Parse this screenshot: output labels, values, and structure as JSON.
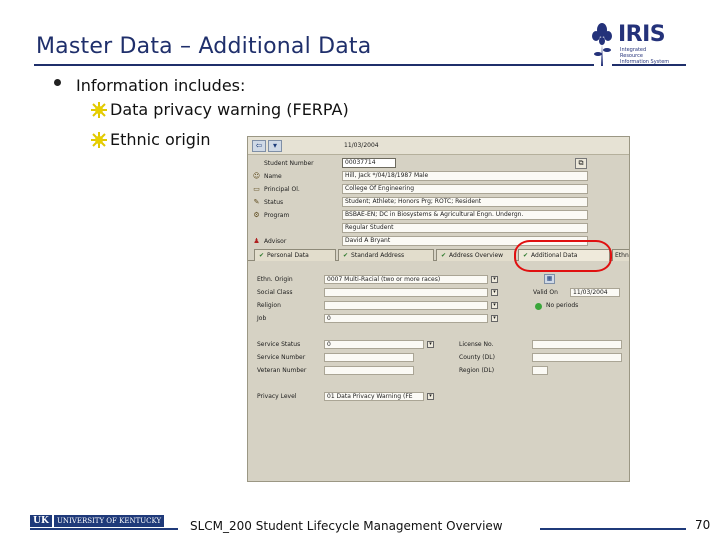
{
  "slide": {
    "title": "Master Data – Additional Data",
    "bullet": "Information includes:",
    "sub_bullets": [
      "Data privacy warning (FERPA)",
      "Ethnic origin"
    ],
    "footer": "SLCM_200 Student Lifecycle Management Overview",
    "page_number": "70",
    "university": "UNIVERSITY OF KENTUCKY",
    "uk_mark": "UK"
  },
  "logo": {
    "word": "IRIS",
    "sub_line1": "Integrated Resource",
    "sub_line2": "Information System"
  },
  "sap": {
    "toolbar_date": "11/03/2004",
    "header_rows": [
      {
        "label": "Student Number",
        "value": "00037714",
        "icon": "student-icon"
      },
      {
        "label": "Name",
        "value": "Hill, Jack */04/18/1987 Male",
        "icon": "person-icon"
      },
      {
        "label": "Principal Ol.",
        "value": "College Of Engineering",
        "icon": "org-icon"
      },
      {
        "label": "Status",
        "value": "Student; Athlete; Honors Prg; ROTC; Resident",
        "icon": "status-icon"
      },
      {
        "label": "Program",
        "value": "BSBAE-EN; DC in Biosystems & Agricultural Engn. Undergn.",
        "icon": "program-icon"
      },
      {
        "label": "",
        "value": "Regular Student",
        "icon": ""
      },
      {
        "label": "Advisor",
        "value": "David A Bryant",
        "icon": "advisor-icon"
      }
    ],
    "tabs": [
      "Personal Data",
      "Standard Address",
      "Address Overview",
      "Additional Data",
      "Ethn"
    ],
    "left_fields": [
      {
        "label": "Ethn. Origin",
        "value": "0007 Multi-Racial (two or more races)"
      },
      {
        "label": "Social Class",
        "value": ""
      },
      {
        "label": "Religion",
        "value": ""
      },
      {
        "label": "Job",
        "value": "0"
      }
    ],
    "valid_on_label": "Valid On",
    "valid_on_value": "11/03/2004",
    "no_periods": "No periods",
    "service_fields": [
      {
        "label": "Service Status",
        "value": "0"
      },
      {
        "label": "Service Number",
        "value": ""
      },
      {
        "label": "Veteran Number",
        "value": ""
      }
    ],
    "license_fields": [
      {
        "label": "License No.",
        "value": ""
      },
      {
        "label": "County (DL)",
        "value": ""
      },
      {
        "label": "Region (DL)",
        "value": ""
      }
    ],
    "privacy_label": "Privacy Level",
    "privacy_value": "01 Data Privacy Warning (FE"
  },
  "colors": {
    "title": "#1f2f6b",
    "highlight_circle": "#e01010",
    "bullet_star": "#e8d000",
    "sap_background": "#d6d2c4"
  }
}
